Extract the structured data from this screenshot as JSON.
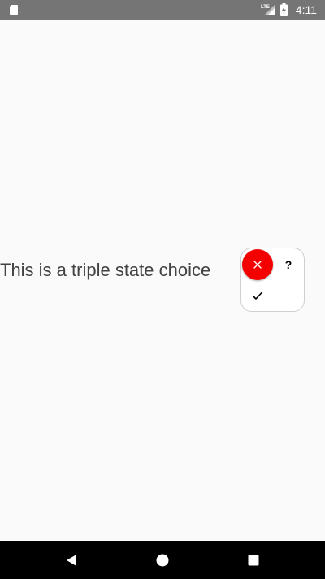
{
  "status_bar": {
    "time": "4:11",
    "network_label": "LTE",
    "icons": [
      "sd-card-icon",
      "lte-signal-icon",
      "battery-charging-icon"
    ]
  },
  "main": {
    "prompt": "This is a triple state choice"
  },
  "triple_choice": {
    "selected": "no",
    "unknown_label": "?",
    "options": [
      {
        "id": "no",
        "icon": "close-icon",
        "color": "#f50000"
      },
      {
        "id": "unknown",
        "icon": "question-mark"
      },
      {
        "id": "yes",
        "icon": "checkmark-icon"
      }
    ]
  },
  "nav_bar": {
    "buttons": [
      "back-icon",
      "home-icon",
      "recents-icon"
    ]
  }
}
